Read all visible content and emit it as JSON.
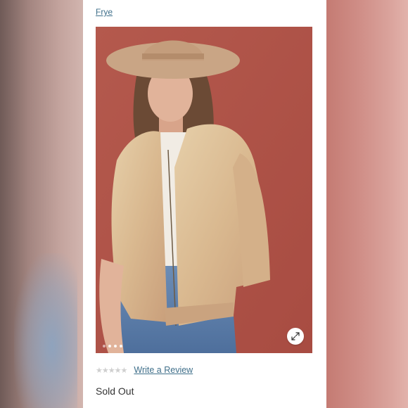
{
  "product": {
    "brand_link": "Frye",
    "gallery": {
      "slide_count": 4,
      "active_slide": 1,
      "expand_icon": "expand-arrows-icon"
    },
    "rating": {
      "stars_filled": 0,
      "stars_total": 5,
      "star_glyph": "★",
      "write_review_label": "Write a Review"
    },
    "availability": "Sold Out"
  },
  "colors": {
    "link": "#3f6f8a",
    "backdrop": "#b5574b",
    "star_empty": "#cfcfcf"
  }
}
